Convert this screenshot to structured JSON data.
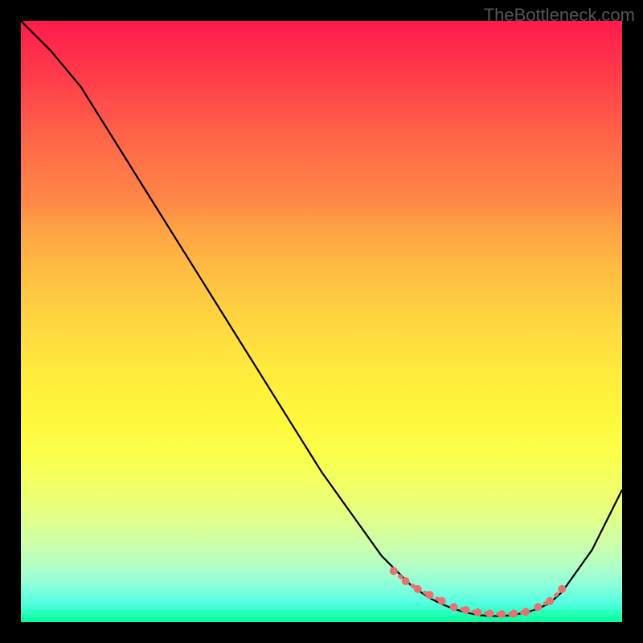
{
  "watermark": "TheBottleneck.com",
  "chart_data": {
    "type": "line",
    "title": "",
    "xlabel": "",
    "ylabel": "",
    "xlim": [
      0,
      100
    ],
    "ylim": [
      0,
      100
    ],
    "curve": {
      "x": [
        0,
        5,
        10,
        15,
        20,
        25,
        30,
        35,
        40,
        45,
        50,
        55,
        60,
        62,
        65,
        68,
        70,
        72,
        74,
        76,
        78,
        80,
        82,
        84,
        86,
        88,
        90,
        95,
        100
      ],
      "y": [
        100,
        95,
        89,
        81,
        73,
        65,
        57,
        49,
        41,
        33,
        25,
        18,
        11,
        9,
        6,
        4,
        3,
        2.2,
        1.6,
        1.2,
        1.0,
        1.0,
        1.2,
        1.6,
        2.2,
        3.2,
        5,
        12,
        22
      ]
    },
    "dotted_segments": [
      {
        "x": [
          62,
          64,
          66,
          68,
          70
        ],
        "y": [
          8.5,
          6.8,
          5.5,
          4.5,
          3.5
        ]
      },
      {
        "x": [
          72,
          74,
          76,
          78,
          80,
          82,
          84
        ],
        "y": [
          2.5,
          2.0,
          1.6,
          1.4,
          1.3,
          1.4,
          1.7
        ]
      },
      {
        "x": [
          86,
          88,
          90
        ],
        "y": [
          2.5,
          3.5,
          5.5
        ]
      }
    ],
    "colors": {
      "curve": "#000000",
      "dots": "#e57373",
      "background_top": "#ff1a4c",
      "background_bottom": "#00ff99"
    }
  }
}
